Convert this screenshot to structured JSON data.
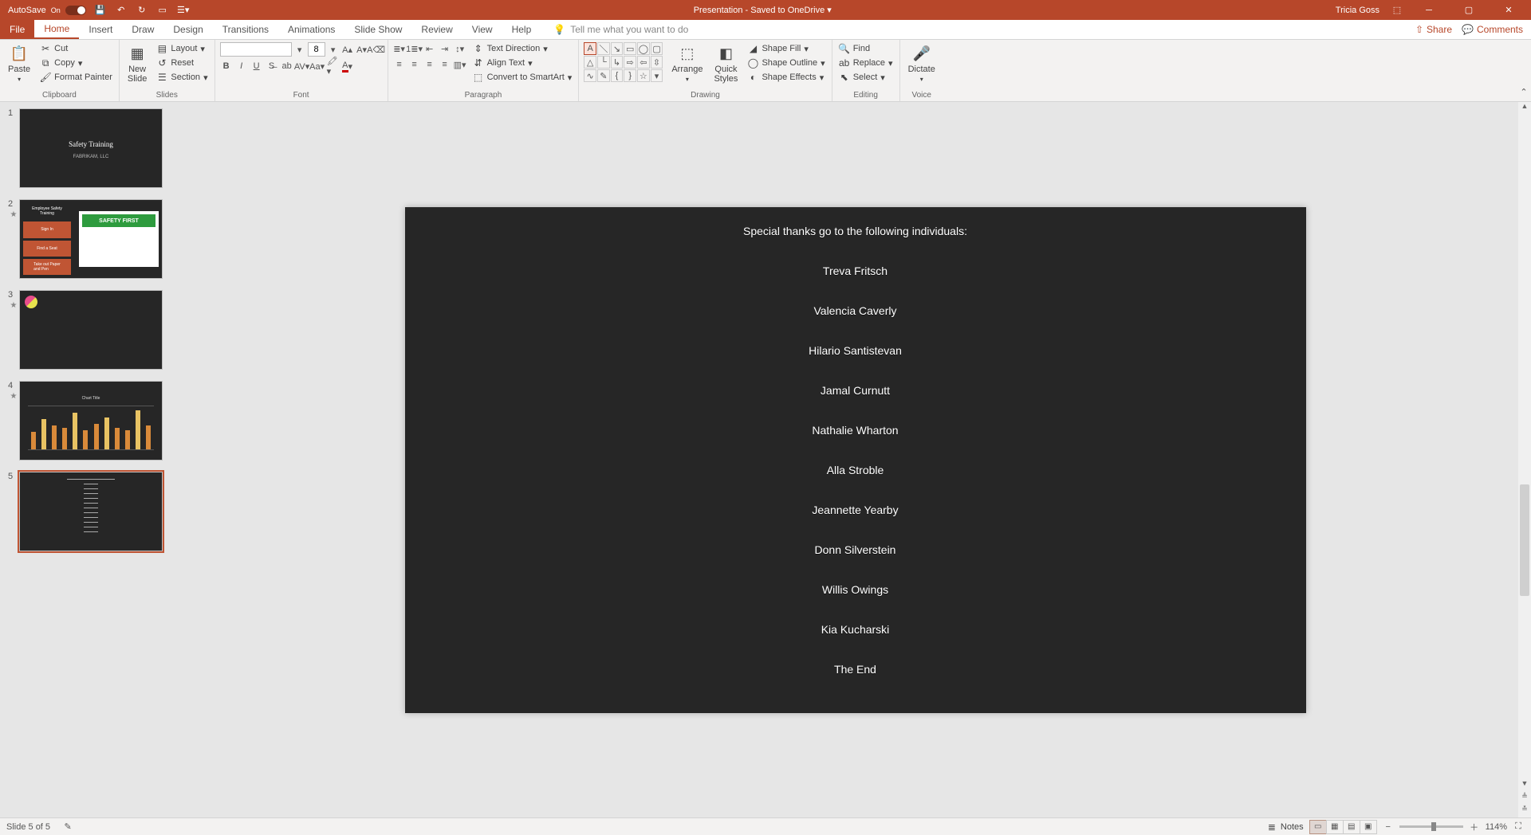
{
  "titlebar": {
    "autosave_label": "AutoSave",
    "autosave_state": "On",
    "title": "Presentation  -  Saved to OneDrive ▾",
    "user": "Tricia Goss"
  },
  "tabs": {
    "file": "File",
    "home": "Home",
    "insert": "Insert",
    "draw": "Draw",
    "design": "Design",
    "transitions": "Transitions",
    "animations": "Animations",
    "slideshow": "Slide Show",
    "review": "Review",
    "view": "View",
    "help": "Help",
    "tellme": "Tell me what you want to do",
    "share": "Share",
    "comments": "Comments"
  },
  "ribbon": {
    "clipboard": {
      "label": "Clipboard",
      "paste": "Paste",
      "cut": "Cut",
      "copy": "Copy",
      "format_painter": "Format Painter"
    },
    "slides": {
      "label": "Slides",
      "new_slide": "New\nSlide",
      "layout": "Layout",
      "reset": "Reset",
      "section": "Section"
    },
    "font": {
      "label": "Font",
      "size": "8"
    },
    "paragraph": {
      "label": "Paragraph",
      "text_direction": "Text Direction",
      "align_text": "Align Text",
      "smartart": "Convert to SmartArt"
    },
    "drawing": {
      "label": "Drawing",
      "arrange": "Arrange",
      "quick_styles": "Quick\nStyles",
      "shape_fill": "Shape Fill",
      "shape_outline": "Shape Outline",
      "shape_effects": "Shape Effects"
    },
    "editing": {
      "label": "Editing",
      "find": "Find",
      "replace": "Replace",
      "select": "Select"
    },
    "voice": {
      "label": "Voice",
      "dictate": "Dictate"
    }
  },
  "slide_panel": {
    "thumb1_title": "Safety Training",
    "thumb1_sub": "FABRIKAM, LLC",
    "thumb2_h": "Employee Safety\nTraining",
    "thumb2_a": "Sign In",
    "thumb2_b": "Find a Seat",
    "thumb2_c": "Take out Paper\nand Pen",
    "thumb2_badge": "SAFETY FIRST",
    "thumb4_title": "Chart Title"
  },
  "slide": {
    "heading": "Special thanks go to the following individuals:",
    "names": [
      "Treva Fritsch",
      "Valencia Caverly",
      "Hilario Santistevan",
      "Jamal Curnutt",
      "Nathalie Wharton",
      "Alla Stroble",
      "Jeannette Yearby",
      "Donn Silverstein",
      "Willis Owings",
      "Kia Kucharski",
      "The End"
    ]
  },
  "status": {
    "slide": "Slide 5 of 5",
    "notes": "Notes",
    "zoom": "114%"
  }
}
